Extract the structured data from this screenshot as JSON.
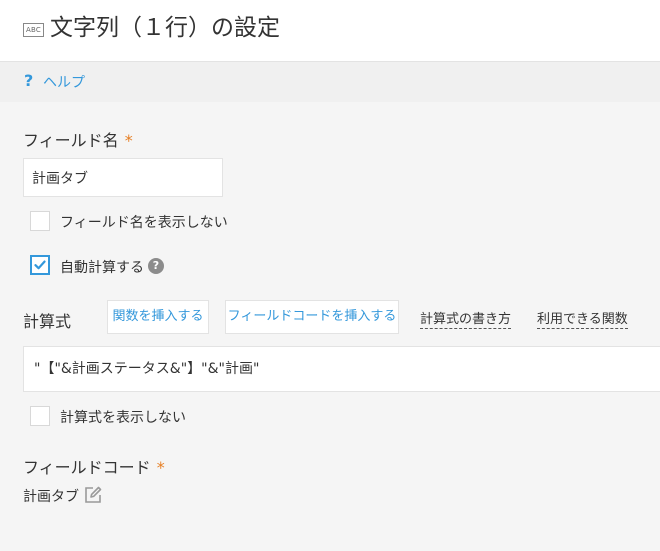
{
  "header": {
    "icon_text": "ABC",
    "title": "文字列（１行）の設定"
  },
  "help": {
    "icon": "?",
    "label": "ヘルプ"
  },
  "field_name": {
    "label": "フィールド名",
    "required_mark": "*",
    "value": "計画タブ"
  },
  "hide_field_name": {
    "label": "フィールド名を表示しない",
    "checked": false
  },
  "auto_calc": {
    "label": "自動計算する",
    "checked": true,
    "help_icon": "?"
  },
  "formula": {
    "label": "計算式",
    "insert_function_button": "関数を挿入する",
    "insert_field_code_button": "フィールドコードを挿入する",
    "how_to_link": "計算式の書き方",
    "available_functions_link": "利用できる関数",
    "value": "\"【\"&計画ステータス&\"】\"&\"計画\""
  },
  "hide_formula": {
    "label": "計算式を表示しない",
    "checked": false
  },
  "field_code": {
    "label": "フィールドコード",
    "required_mark": "*",
    "value": "計画タブ"
  },
  "colors": {
    "accent": "#3498db",
    "required": "#e67e22"
  }
}
